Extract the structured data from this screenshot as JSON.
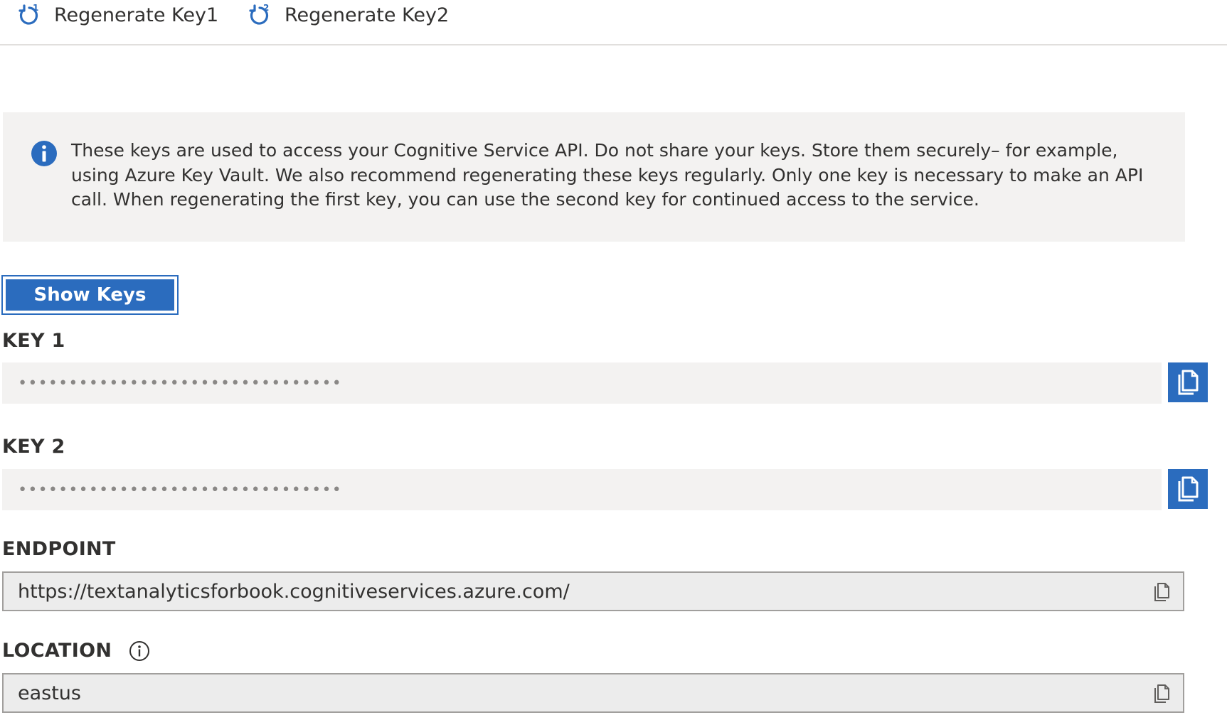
{
  "toolbar": {
    "regen_key1": {
      "label": "Regenerate Key1",
      "icon": "refresh-1-icon"
    },
    "regen_key2": {
      "label": "Regenerate Key2",
      "icon": "refresh-2-icon"
    }
  },
  "info": {
    "icon": "info-icon",
    "line1": "These keys are used to access your Cognitive Service API. Do not share your keys. Store them securely– for example,",
    "line2": "using Azure Key Vault. We also recommend regenerating these keys regularly. Only one key is necessary to make an API",
    "line3": "call. When regenerating the first key, you can use the second key for continued access to the service."
  },
  "show_keys": {
    "label": "Show Keys"
  },
  "key1": {
    "label": "KEY 1",
    "value": "••••••••••••••••••••••••••••••••",
    "copy_icon": "copy-icon"
  },
  "key2": {
    "label": "KEY 2",
    "value": "••••••••••••••••••••••••••••••••",
    "copy_icon": "copy-icon"
  },
  "endpoint": {
    "label": "ENDPOINT",
    "value": "https://textanalyticsforbook.cognitiveservices.azure.com/",
    "copy_icon": "copy-icon"
  },
  "location": {
    "label": "LOCATION",
    "value": "eastus",
    "info_icon": "info-outline-icon",
    "copy_icon": "copy-icon"
  },
  "colors": {
    "accent": "#2b6cbe",
    "banner_bg": "#f3f2f1",
    "field_bg": "#ececec"
  }
}
